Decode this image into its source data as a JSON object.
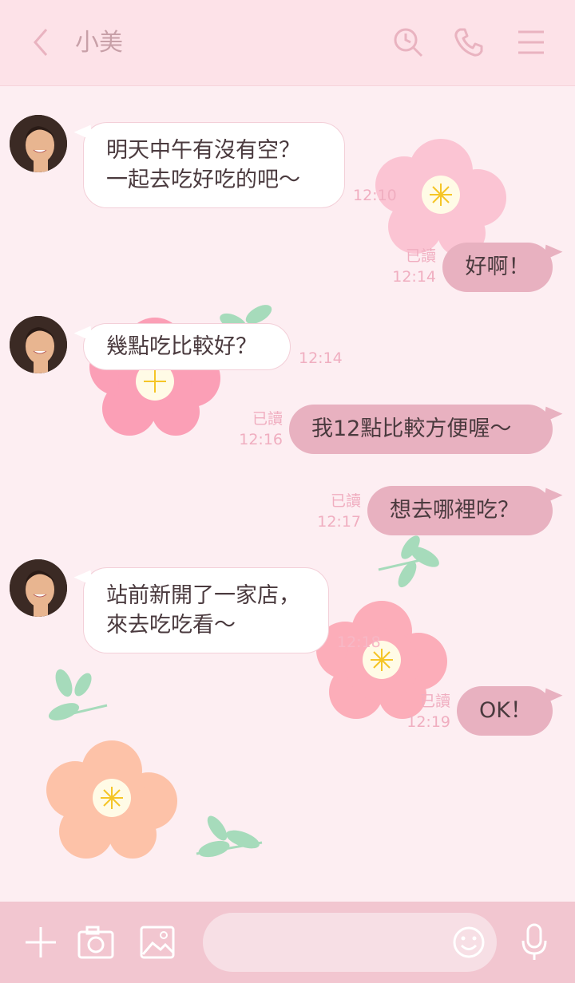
{
  "header": {
    "title": "小美",
    "icons": [
      "back-icon",
      "search-clock-icon",
      "phone-icon",
      "menu-icon"
    ]
  },
  "messages": [
    {
      "side": "in",
      "text_line1": "明天中午有沒有空？",
      "text_line2": "一起去吃好吃的吧～",
      "time": "12:10"
    },
    {
      "side": "out",
      "text": "好啊！",
      "read": "已讀",
      "time": "12:14"
    },
    {
      "side": "in",
      "text": "幾點吃比較好？",
      "time": "12:14"
    },
    {
      "side": "out",
      "text": "我12點比較方便喔～",
      "read": "已讀",
      "time": "12:16"
    },
    {
      "side": "out",
      "text": "想去哪裡吃？",
      "read": "已讀",
      "time": "12:17"
    },
    {
      "side": "in",
      "text_line1": "站前新開了一家店，",
      "text_line2": "來去吃吃看～",
      "time": "12:18"
    },
    {
      "side": "out",
      "text": "OK！",
      "read": "已讀",
      "time": "12:19"
    }
  ],
  "footer": {
    "icons": [
      "plus-icon",
      "camera-icon",
      "image-icon",
      "emoji-icon",
      "microphone-icon"
    ],
    "input_placeholder": ""
  },
  "colors": {
    "header_bg": "#fde2e8",
    "chat_bg": "#fdeef2",
    "outgoing_bubble": "#e8b1c0",
    "footer_bg": "#f2c6d0",
    "meta_text": "#f0aec0"
  }
}
